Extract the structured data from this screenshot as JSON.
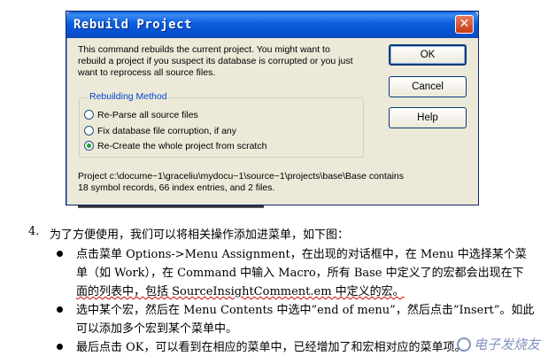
{
  "dialog": {
    "title": "Rebuild Project",
    "message_lines": [
      "This command rebuilds the current project.  You might want to",
      "rebuild a project if you suspect its database is corrupted or you just",
      "want to reprocess all source files."
    ],
    "buttons": {
      "ok": "OK",
      "cancel": "Cancel",
      "help": "Help"
    },
    "group_title": "Rebuilding Method",
    "options": [
      {
        "label": "Re-Parse all source files",
        "selected": false
      },
      {
        "label": "Fix database file corruption, if any",
        "selected": false
      },
      {
        "label": "Re-Create the whole project from scratch",
        "selected": true
      }
    ],
    "info_lines": [
      "Project c:\\docume~1\\graceliu\\mydocu~1\\source~1\\projects\\base\\Base contains",
      "18 symbol records, 66 index entries, and 2 files."
    ]
  },
  "document": {
    "item_number": "4.",
    "item_text": "为了方便使用，我们可以将相关操作添加进菜单，如下图：",
    "bullets": [
      {
        "lines": [
          "点击菜单 Options->Menu Assignment，在出现的对话框中，在 Menu 中选择某个菜",
          "单（如 Work），在 Command 中输入 Macro，所有 Base 中定义了的宏都会出现在下",
          "面的列表中，包括 SourceInsightComment.em 中定义的宏。"
        ]
      },
      {
        "lines": [
          "选中某个宏，然后在 Menu Contents 中选中”end of menu”，然后点击”Insert”。如此",
          "可以添加多个宏到某个菜单中。"
        ]
      },
      {
        "lines": [
          "最后点击 OK，可以看到在相应的菜单中，已经增加了和宏相对应的菜单项。"
        ]
      }
    ]
  },
  "watermark": "电子发烧友"
}
